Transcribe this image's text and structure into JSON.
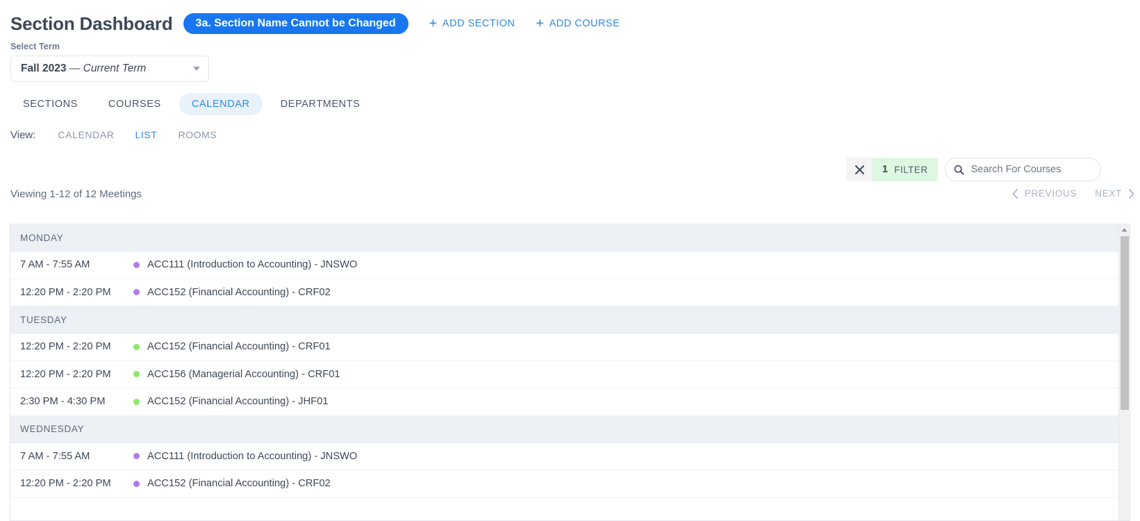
{
  "header": {
    "title": "Section Dashboard",
    "badge": "3a. Section Name Cannot be Changed",
    "badge_color": "#1976f0",
    "actions": [
      {
        "label": "ADD SECTION",
        "icon": "plus-icon"
      },
      {
        "label": "ADD COURSE",
        "icon": "plus-icon"
      }
    ]
  },
  "term": {
    "label": "Select Term",
    "value_bold": "Fall 2023",
    "value_italic": "— Current Term",
    "icon": "chevron-down-icon"
  },
  "main_tabs": [
    {
      "label": "SECTIONS",
      "active": false
    },
    {
      "label": "COURSES",
      "active": false
    },
    {
      "label": "CALENDAR",
      "active": true
    },
    {
      "label": "DEPARTMENTS",
      "active": false
    }
  ],
  "view": {
    "label": "View:",
    "options": [
      {
        "label": "CALENDAR",
        "active": false
      },
      {
        "label": "LIST",
        "active": true
      },
      {
        "label": "ROOMS",
        "active": false
      }
    ]
  },
  "filter": {
    "clear_icon": "close-icon",
    "count": "1",
    "label": "FILTER",
    "badge_color": "#ddf7e0"
  },
  "search": {
    "icon": "search-icon",
    "placeholder": "Search For Courses",
    "value": ""
  },
  "pagination": {
    "viewing": "Viewing 1-12 of 12 Meetings",
    "previous": "PREVIOUS",
    "next": "NEXT",
    "prev_icon": "chevron-left-icon",
    "next_icon": "chevron-right-icon"
  },
  "colors": {
    "dot_purple": "#b07ce8",
    "dot_green": "#8ee66b",
    "accent_blue": "#2f8ae0",
    "day_header_bg": "#edf1f6"
  },
  "list": [
    {
      "day": "MONDAY",
      "meetings": [
        {
          "time": "7 AM - 7:55 AM",
          "name": "ACC111 (Introduction to Accounting) - JNSWO",
          "dot": "#b07ce8"
        },
        {
          "time": "12:20 PM - 2:20 PM",
          "name": "ACC152 (Financial Accounting) - CRF02",
          "dot": "#b07ce8"
        }
      ]
    },
    {
      "day": "TUESDAY",
      "meetings": [
        {
          "time": "12:20 PM - 2:20 PM",
          "name": "ACC152 (Financial Accounting) - CRF01",
          "dot": "#8ee66b"
        },
        {
          "time": "12:20 PM - 2:20 PM",
          "name": "ACC156 (Managerial Accounting) - CRF01",
          "dot": "#8ee66b"
        },
        {
          "time": "2:30 PM - 4:30 PM",
          "name": "ACC152 (Financial Accounting) - JHF01",
          "dot": "#8ee66b"
        }
      ]
    },
    {
      "day": "WEDNESDAY",
      "meetings": [
        {
          "time": "7 AM - 7:55 AM",
          "name": "ACC111 (Introduction to Accounting) - JNSWO",
          "dot": "#b07ce8"
        },
        {
          "time": "12:20 PM - 2:20 PM",
          "name": "ACC152 (Financial Accounting) - CRF02",
          "dot": "#b07ce8"
        }
      ]
    }
  ],
  "scrollbar": {
    "up_icon": "caret-up-icon"
  }
}
